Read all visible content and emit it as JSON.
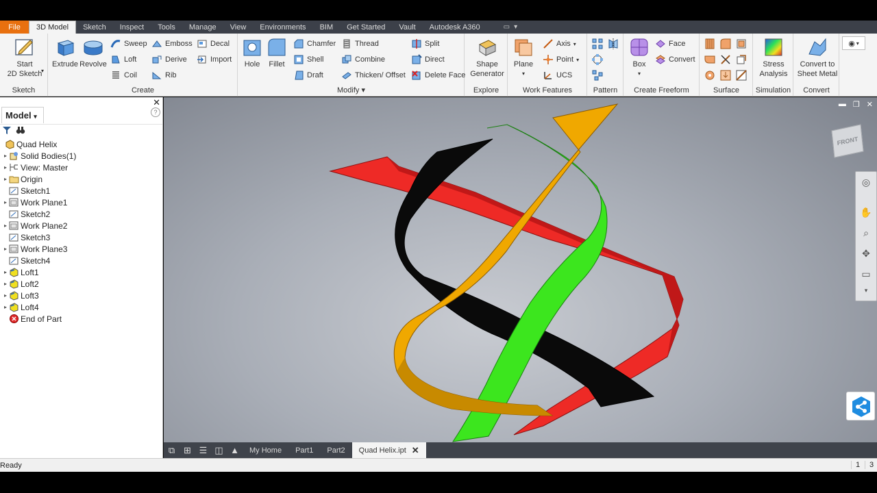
{
  "tabs": [
    "File",
    "3D Model",
    "Sketch",
    "Inspect",
    "Tools",
    "Manage",
    "View",
    "Environments",
    "BIM",
    "Get Started",
    "Vault",
    "Autodesk A360"
  ],
  "active_tab": "3D Model",
  "ribbon": {
    "sketch": {
      "title": "Sketch",
      "start_line1": "Start",
      "start_line2": "2D Sketch"
    },
    "create": {
      "title": "Create",
      "extrude": "Extrude",
      "revolve": "Revolve",
      "sweep": "Sweep",
      "loft": "Loft",
      "coil": "Coil",
      "emboss": "Emboss",
      "derive": "Derive",
      "rib": "Rib",
      "decal": "Decal",
      "import": "Import"
    },
    "modify": {
      "title": "Modify",
      "hole": "Hole",
      "fillet": "Fillet",
      "chamfer": "Chamfer",
      "shell": "Shell",
      "draft": "Draft",
      "thread": "Thread",
      "combine": "Combine",
      "thicken": "Thicken/ Offset",
      "split": "Split",
      "direct": "Direct",
      "delete_face": "Delete Face"
    },
    "explore": {
      "title": "Explore",
      "shape_line1": "Shape",
      "shape_line2": "Generator"
    },
    "work_features": {
      "title": "Work Features",
      "plane": "Plane",
      "axis": "Axis",
      "point": "Point",
      "ucs": "UCS"
    },
    "pattern": {
      "title": "Pattern"
    },
    "freeform": {
      "title": "Create Freeform",
      "box": "Box",
      "face": "Face",
      "convert": "Convert"
    },
    "surface": {
      "title": "Surface"
    },
    "simulation": {
      "title": "Simulation",
      "stress_line1": "Stress",
      "stress_line2": "Analysis"
    },
    "convert": {
      "title": "Convert",
      "sheet_line1": "Convert to",
      "sheet_line2": "Sheet Metal"
    }
  },
  "browser": {
    "header": "Model",
    "tree": [
      {
        "label": "Quad Helix",
        "expandable": false,
        "indent": 0,
        "icon": "part-icon"
      },
      {
        "label": "Solid Bodies(1)",
        "expandable": true,
        "indent": 1,
        "icon": "solid-bodies-icon"
      },
      {
        "label": "View: Master",
        "expandable": true,
        "indent": 1,
        "icon": "view-icon"
      },
      {
        "label": "Origin",
        "expandable": true,
        "indent": 1,
        "icon": "folder-icon"
      },
      {
        "label": "Sketch1",
        "expandable": false,
        "indent": 1,
        "icon": "sketch-icon"
      },
      {
        "label": "Work Plane1",
        "expandable": true,
        "indent": 1,
        "icon": "work-plane-icon"
      },
      {
        "label": "Sketch2",
        "expandable": false,
        "indent": 1,
        "icon": "sketch-icon"
      },
      {
        "label": "Work Plane2",
        "expandable": true,
        "indent": 1,
        "icon": "work-plane-icon"
      },
      {
        "label": "Sketch3",
        "expandable": false,
        "indent": 1,
        "icon": "sketch-icon"
      },
      {
        "label": "Work Plane3",
        "expandable": true,
        "indent": 1,
        "icon": "work-plane-icon"
      },
      {
        "label": "Sketch4",
        "expandable": false,
        "indent": 1,
        "icon": "sketch-icon"
      },
      {
        "label": "Loft1",
        "expandable": true,
        "indent": 1,
        "icon": "loft-icon"
      },
      {
        "label": "Loft2",
        "expandable": true,
        "indent": 1,
        "icon": "loft-icon"
      },
      {
        "label": "Loft3",
        "expandable": true,
        "indent": 1,
        "icon": "loft-icon"
      },
      {
        "label": "Loft4",
        "expandable": true,
        "indent": 1,
        "icon": "loft-icon"
      },
      {
        "label": "End of Part",
        "expandable": false,
        "indent": 1,
        "icon": "end-of-part-icon"
      }
    ]
  },
  "viewcube": {
    "label": "FRONT"
  },
  "document_tabs": [
    "My Home",
    "Part1",
    "Part2",
    "Quad Helix.ipt"
  ],
  "active_document": "Quad Helix.ipt",
  "status": {
    "text": "Ready",
    "num1": "1",
    "num2": "3"
  },
  "colors": {
    "file_tab": "#e8700f",
    "helix_red": "#ee2a26",
    "helix_black": "#0a0a0a",
    "helix_green": "#3ce61e",
    "helix_orange": "#f0a800"
  }
}
